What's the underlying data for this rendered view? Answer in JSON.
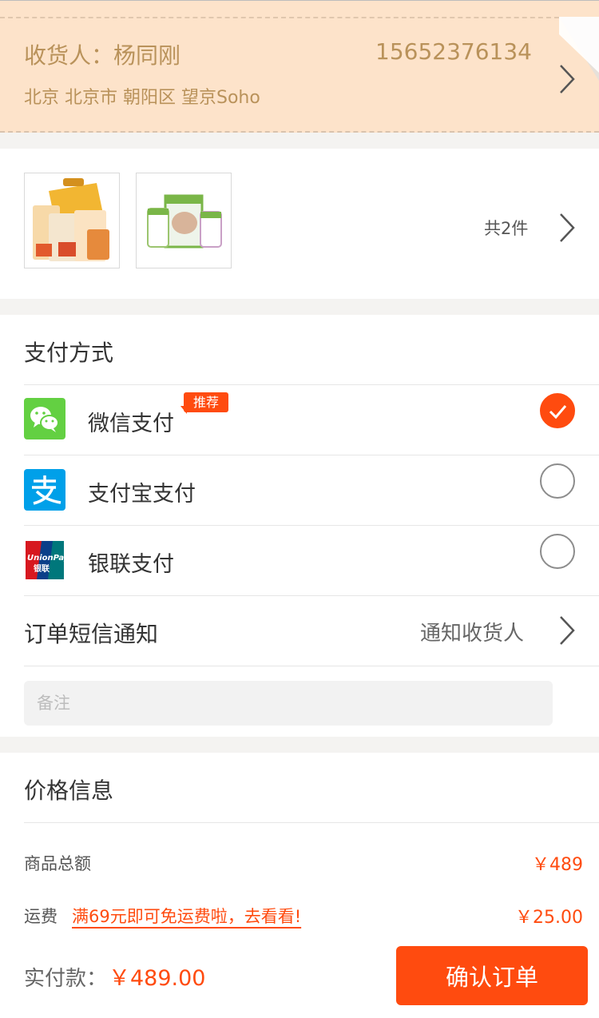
{
  "address": {
    "name_label": "收货人：杨同刚",
    "phone": "15652376134",
    "line": "北京 北京市 朝阳区 望京Soho"
  },
  "goods": {
    "count_text": "共2件",
    "items": [
      {
        "name": "snack-gift-box"
      },
      {
        "name": "body-cleanse-supplement"
      }
    ]
  },
  "payment": {
    "title": "支付方式",
    "recommend_badge": "推荐",
    "options": [
      {
        "label": "微信支付",
        "icon": "wechat-pay-icon",
        "selected": true
      },
      {
        "label": "支付宝支付",
        "icon": "alipay-icon",
        "selected": false
      },
      {
        "label": "银联支付",
        "icon": "unionpay-icon",
        "selected": false
      }
    ]
  },
  "sms": {
    "label": "订单短信通知",
    "value": "通知收货人"
  },
  "note": {
    "placeholder": "备注"
  },
  "price": {
    "title": "价格信息",
    "goods_total_label": "商品总额",
    "goods_total_value": "￥489",
    "shipping_label": "运费",
    "shipping_promo": "满69元即可免运费啦，去看看!",
    "shipping_value": "￥25.00"
  },
  "footer": {
    "total_label": "实付款：",
    "total_value": "￥489.00",
    "confirm_label": "确认订单"
  },
  "colors": {
    "accent": "#ff4b0f",
    "address_bg": "#fde3ca",
    "address_text": "#b9925a",
    "wechat_green": "#63d042",
    "alipay_blue": "#00a0e9"
  }
}
